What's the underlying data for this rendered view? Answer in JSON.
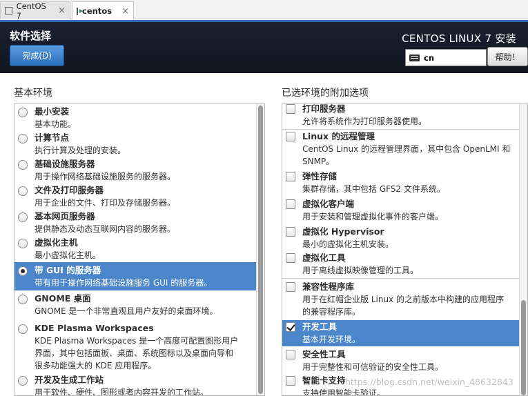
{
  "tabs": [
    {
      "label": "CentOS 7",
      "active": false,
      "close": "×"
    },
    {
      "label": "centos",
      "active": true,
      "close": "×"
    }
  ],
  "header": {
    "title": "软件选择",
    "done_label": "完成(D)",
    "product": "CENTOS LINUX 7 安装",
    "keyboard_layout": "cn",
    "help_label": "帮助！"
  },
  "left": {
    "heading": "基本环境",
    "items": [
      {
        "title": "最小安装",
        "desc": "基本功能。",
        "selected": false
      },
      {
        "title": "计算节点",
        "desc": "执行计算及处理的安装。",
        "selected": false
      },
      {
        "title": "基础设施服务器",
        "desc": "用于操作网络基础设施服务的服务器。",
        "selected": false
      },
      {
        "title": "文件及打印服务器",
        "desc": "用于企业的文件、打印及存储服务器。",
        "selected": false
      },
      {
        "title": "基本网页服务器",
        "desc": "提供静态及动态互联网内容的服务器。",
        "selected": false
      },
      {
        "title": "虚拟化主机",
        "desc": "最小虚拟化主机。",
        "selected": false
      },
      {
        "title": "带 GUI 的服务器",
        "desc": "带有用于操作网络基础设施服务 GUI 的服务器。",
        "selected": true
      },
      {
        "title": "GNOME 桌面",
        "desc": "GNOME 是一个非常直观且用户友好的桌面环境。",
        "selected": false
      },
      {
        "title": "KDE Plasma Workspaces",
        "desc": "KDE Plasma Workspaces 是一个高度可配置图形用户界面，其中包括面板、桌面、系统图标以及桌面向导和很多功能强大的 KDE 应用程序。",
        "desc_lines": [
          "KDE Plasma Workspaces 是一个高度可配置图形用户",
          "界面，其中包括面板、桌面、系统图标以及桌面向导和",
          "很多功能强大的 KDE 应用程序。"
        ],
        "selected": false
      },
      {
        "title": "开发及生成工作站",
        "desc": "用于软件、硬件、图形或者内容开发的工作站。",
        "selected": false
      }
    ]
  },
  "right": {
    "heading": "已选环境的附加选项",
    "items": [
      {
        "title": "打印服务器",
        "desc_lines": [
          "允许将系统作为打印服务器使用。"
        ],
        "checked": false
      },
      {
        "title": "Linux 的远程管理",
        "desc_lines": [
          "CentOS Linux 的远程管理界面，其中包含 OpenLMI 和",
          "SNMP。"
        ],
        "checked": false
      },
      {
        "title": "弹性存储",
        "desc_lines": [
          "集群存储，其中包括 GFS2 文件系统。"
        ],
        "checked": false
      },
      {
        "title": "虚拟化客户端",
        "desc_lines": [
          "用于安装和管理虚拟化事件的客户端。"
        ],
        "checked": false
      },
      {
        "title": "虚拟化 Hypervisor",
        "desc_lines": [
          "最小的虚拟化主机安装。"
        ],
        "checked": false
      },
      {
        "title": "虚拟化工具",
        "desc_lines": [
          "用于离线虚拟映像管理的工具。"
        ],
        "checked": false
      },
      {
        "title": "兼容性程序库",
        "desc_lines": [
          "用于在红帽企业版 Linux 的之前版本中构建的应用程序",
          "的兼容程序库。"
        ],
        "checked": false
      },
      {
        "title": "开发工具",
        "desc_lines": [
          "基本开发环境。"
        ],
        "checked": true
      },
      {
        "title": "安全性工具",
        "desc_lines": [
          "用于完整性和可信验证的安全性工具。"
        ],
        "checked": false
      },
      {
        "title": "智能卡支持",
        "desc_lines": [
          "支持使用智能卡验证。"
        ],
        "checked": false
      }
    ]
  },
  "watermark": "https://blog.csdn.net/weixin_48632843",
  "colors": {
    "selection": "#4a86c9",
    "header_bg": "#151a26",
    "header_accent": "#2d6dba",
    "done_button": "#3a82cf"
  }
}
